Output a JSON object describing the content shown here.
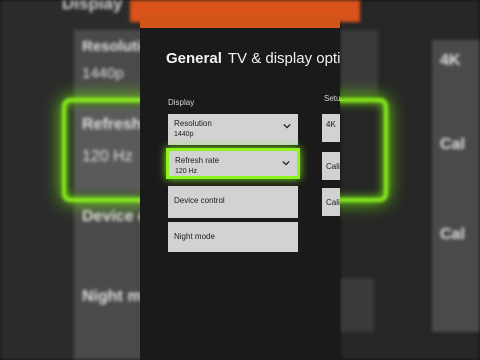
{
  "background": {
    "top_heading": "Display",
    "tiles": [
      {
        "label": "Resolution",
        "value": "1440p"
      },
      {
        "label": "Refresh",
        "value": "120 Hz"
      },
      {
        "label": "Device c"
      },
      {
        "label": "Night m"
      }
    ],
    "right_tiles": [
      "4K",
      "Cal",
      "Cal"
    ]
  },
  "screen": {
    "breadcrumb": "General",
    "title": "TV & display optio",
    "display_section": "Display",
    "setup_section": "Setu",
    "items": [
      {
        "label": "Resolution",
        "value": "1440p"
      },
      {
        "label": "Refresh rate",
        "value": "120 Hz"
      },
      {
        "label": "Device control"
      },
      {
        "label": "Night mode"
      }
    ],
    "side_items": [
      "4K",
      "Cali",
      "Cali"
    ]
  },
  "colors": {
    "focus_glow": "#8cf51b",
    "header_orange": "#d35418",
    "tile": "#d2d2d2"
  },
  "icons": [
    "chevron-down-icon"
  ]
}
